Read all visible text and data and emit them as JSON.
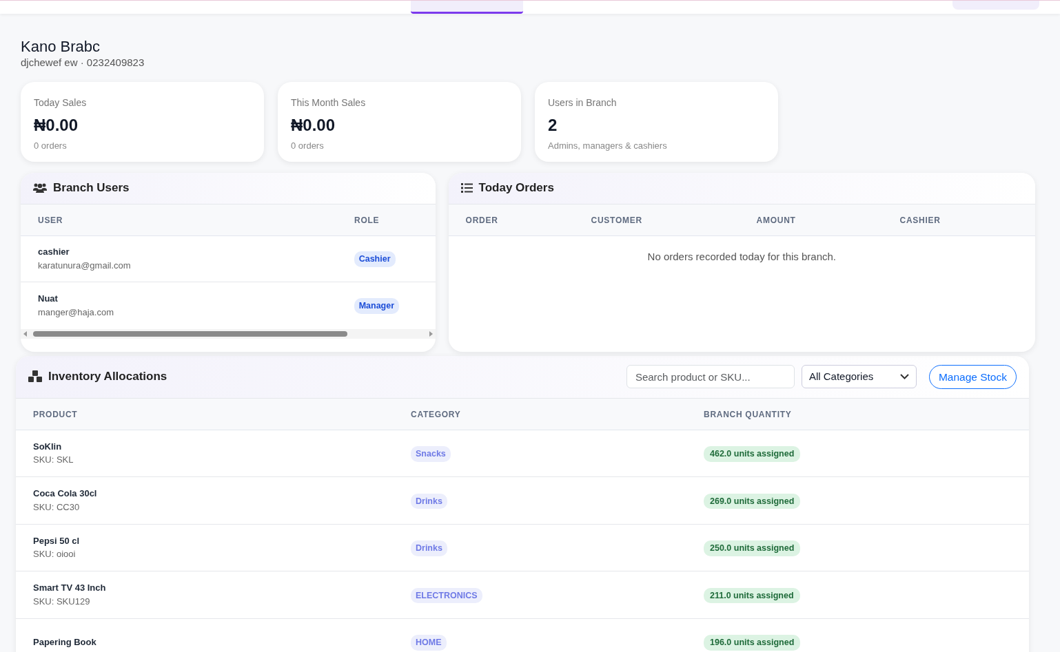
{
  "branch": {
    "name": "Kano Brabc",
    "subtitle": "djchewef ew · 0232409823"
  },
  "stats": [
    {
      "label": "Today Sales",
      "value": "₦0.00",
      "note": "0 orders"
    },
    {
      "label": "This Month Sales",
      "value": "₦0.00",
      "note": "0 orders"
    },
    {
      "label": "Users in Branch",
      "value": "2",
      "note": "Admins, managers & cashiers"
    }
  ],
  "branch_users": {
    "title": "Branch Users",
    "columns": [
      "USER",
      "ROLE"
    ],
    "rows": [
      {
        "name": "cashier",
        "email": "karatunura@gmail.com",
        "role": "Cashier"
      },
      {
        "name": "Nuat",
        "email": "manger@haja.com",
        "role": "Manager"
      }
    ]
  },
  "today_orders": {
    "title": "Today Orders",
    "columns": [
      "ORDER",
      "CUSTOMER",
      "AMOUNT",
      "CASHIER"
    ],
    "empty_message": "No orders recorded today for this branch."
  },
  "inventory": {
    "title": "Inventory Allocations",
    "search": {
      "placeholder": "Search product or SKU..."
    },
    "category_filter": "All Categories",
    "manage_button": "Manage Stock",
    "columns": [
      "PRODUCT",
      "CATEGORY",
      "BRANCH QUANTITY"
    ],
    "rows": [
      {
        "product": "SoKlin",
        "sku": "SKU: SKL",
        "category": "Snacks",
        "quantity": "462.0 units assigned"
      },
      {
        "product": "Coca Cola 30cl",
        "sku": "SKU: CC30",
        "category": "Drinks",
        "quantity": "269.0 units assigned"
      },
      {
        "product": "Pepsi 50 cl",
        "sku": "SKU: oiooi",
        "category": "Drinks",
        "quantity": "250.0 units assigned"
      },
      {
        "product": "Smart TV 43 Inch",
        "sku": "SKU: SKU129",
        "category": "ELECTRONICS",
        "quantity": "211.0 units assigned"
      },
      {
        "product": "Papering Book",
        "category": "HOME",
        "quantity": "196.0 units assigned"
      }
    ]
  }
}
